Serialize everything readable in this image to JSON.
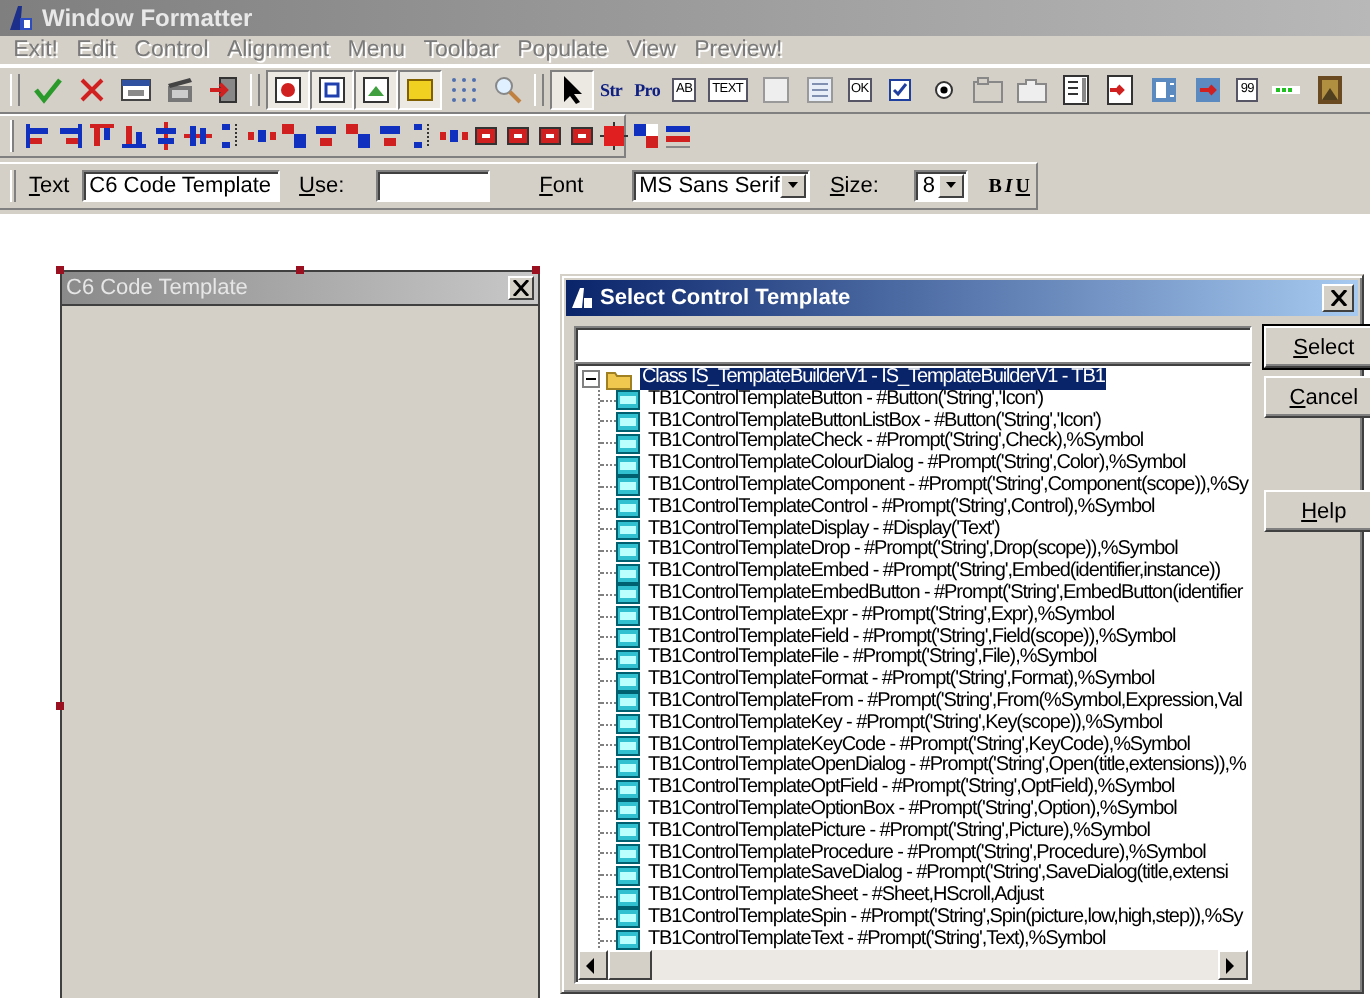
{
  "window": {
    "title": "Window Formatter"
  },
  "menu": [
    {
      "label": "Exit!",
      "disabled": true
    },
    {
      "label": "Edit",
      "disabled": true
    },
    {
      "label": "Control",
      "disabled": true
    },
    {
      "label": "Alignment",
      "disabled": true
    },
    {
      "label": "Menu",
      "disabled": true
    },
    {
      "label": "Toolbar",
      "disabled": true
    },
    {
      "label": "Populate",
      "disabled": true
    },
    {
      "label": "View",
      "disabled": true
    },
    {
      "label": "Preview!",
      "disabled": true
    }
  ],
  "toolbar": [
    {
      "pressed": false
    },
    {
      "pressed": false
    },
    {
      "pressed": false
    },
    {
      "pressed": false
    },
    {
      "pressed": false
    },
    {
      "pressed": true
    },
    {
      "pressed": true
    },
    {
      "pressed": true
    },
    {
      "pressed": true
    },
    {
      "pressed": false
    },
    {
      "pressed": false
    },
    {
      "pressed": true
    },
    {
      "label": "Str",
      "pressed": false
    },
    {
      "label": "Pro",
      "pressed": false
    },
    {
      "label": "AB",
      "pressed": false
    },
    {
      "label": "TEXT",
      "pressed": false
    },
    {
      "pressed": false
    },
    {
      "pressed": false
    },
    {
      "label": "OK",
      "pressed": false
    },
    {
      "pressed": false
    },
    {
      "pressed": false
    },
    {
      "pressed": false
    },
    {
      "pressed": false
    },
    {
      "pressed": false
    },
    {
      "pressed": false
    },
    {
      "pressed": false
    },
    {
      "pressed": false
    },
    {
      "label": "99",
      "pressed": false
    },
    {
      "pressed": false
    },
    {
      "pressed": false
    }
  ],
  "format_bar": {
    "text_label": "Text",
    "text_value": "C6 Code Template",
    "use_label": "Use:",
    "font_label": "Font",
    "font_value": "MS Sans Serif",
    "size_label": "Size:",
    "size_value": "8",
    "style_buttons": [
      "B",
      "I",
      "U"
    ]
  },
  "form_window": {
    "title": "C6 Code Template"
  },
  "dialog": {
    "title": "Select Control Template",
    "buttons": [
      "Select",
      "Cancel",
      "Help"
    ],
    "tree": {
      "label": "Class IS_TemplateBuilderV1 - IS_TemplateBuilderV1 - TB1",
      "expanded": true,
      "selected": true,
      "children": [
        {
          "label": "TB1ControlTemplateButton - #Button('String','Icon')",
          "selected": false
        },
        {
          "label": "TB1ControlTemplateButtonListBox - #Button('String','Icon')",
          "selected": false
        },
        {
          "label": "TB1ControlTemplateCheck - #Prompt('String',Check),%Symbol",
          "selected": false
        },
        {
          "label": "TB1ControlTemplateColourDialog - #Prompt('String',Color),%Symbol",
          "selected": false
        },
        {
          "label": "TB1ControlTemplateComponent - #Prompt('String',Component(scope)),%Sy",
          "selected": false
        },
        {
          "label": "TB1ControlTemplateControl - #Prompt('String',Control),%Symbol",
          "selected": false
        },
        {
          "label": "TB1ControlTemplateDisplay - #Display('Text')",
          "selected": false
        },
        {
          "label": "TB1ControlTemplateDrop - #Prompt('String',Drop(scope)),%Symbol",
          "selected": false
        },
        {
          "label": "TB1ControlTemplateEmbed - #Prompt('String',Embed(identifier,instance))",
          "selected": false
        },
        {
          "label": "TB1ControlTemplateEmbedButton - #Prompt('String',EmbedButton(identifier",
          "selected": false
        },
        {
          "label": "TB1ControlTemplateExpr - #Prompt('String',Expr),%Symbol",
          "selected": false
        },
        {
          "label": "TB1ControlTemplateField - #Prompt('String',Field(scope)),%Symbol",
          "selected": false
        },
        {
          "label": "TB1ControlTemplateFile - #Prompt('String',File),%Symbol",
          "selected": false
        },
        {
          "label": "TB1ControlTemplateFormat - #Prompt('String',Format),%Symbol",
          "selected": false
        },
        {
          "label": "TB1ControlTemplateFrom - #Prompt('String',From(%Symbol,Expression,Val",
          "selected": false
        },
        {
          "label": "TB1ControlTemplateKey - #Prompt('String',Key(scope)),%Symbol",
          "selected": false
        },
        {
          "label": "TB1ControlTemplateKeyCode - #Prompt('String',KeyCode),%Symbol",
          "selected": false
        },
        {
          "label": "TB1ControlTemplateOpenDialog - #Prompt('String',Open(title,extensions)),%",
          "selected": false
        },
        {
          "label": "TB1ControlTemplateOptField - #Prompt('String',OptField),%Symbol",
          "selected": false
        },
        {
          "label": "TB1ControlTemplateOptionBox - #Prompt('String',Option),%Symbol",
          "selected": false
        },
        {
          "label": "TB1ControlTemplatePicture - #Prompt('String',Picture),%Symbol",
          "selected": false
        },
        {
          "label": "TB1ControlTemplateProcedure - #Prompt('String',Procedure),%Symbol",
          "selected": false
        },
        {
          "label": "TB1ControlTemplateSaveDialog - #Prompt('String',SaveDialog(title,extensi",
          "selected": false
        },
        {
          "label": "TB1ControlTemplateSheet - #Sheet,HScroll,Adjust",
          "selected": false
        },
        {
          "label": "TB1ControlTemplateSpin - #Prompt('String',Spin(picture,low,high,step)),%Sy",
          "selected": false
        },
        {
          "label": "TB1ControlTemplateText - #Prompt('String',Text),%Symbol",
          "selected": false
        }
      ]
    }
  }
}
